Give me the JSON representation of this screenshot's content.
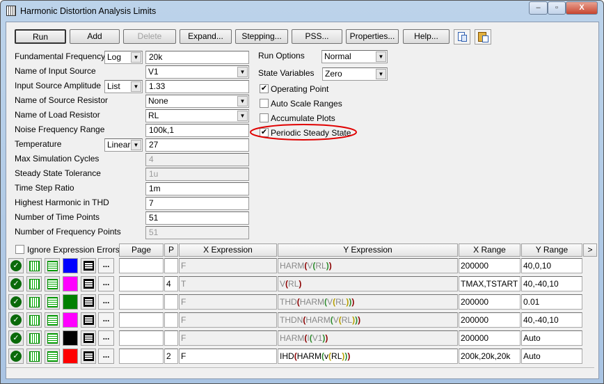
{
  "window": {
    "title": "Harmonic Distortion Analysis Limits",
    "minimize": "–",
    "maximize": "▫",
    "close": "X"
  },
  "toolbar": {
    "buttons": [
      {
        "label": "Run",
        "enabled": true
      },
      {
        "label": "Add",
        "enabled": true
      },
      {
        "label": "Delete",
        "enabled": false
      },
      {
        "label": "Expand...",
        "enabled": true
      },
      {
        "label": "Stepping...",
        "enabled": true
      },
      {
        "label": "PSS...",
        "enabled": true
      },
      {
        "label": "Properties...",
        "enabled": true
      },
      {
        "label": "Help...",
        "enabled": true
      }
    ],
    "copy_icon": "copy-icon",
    "paste_icon": "paste-icon"
  },
  "fields": [
    {
      "label": "Fundamental Frequency",
      "mode": "Log",
      "value": "20k",
      "type": "text"
    },
    {
      "label": "Name of Input Source",
      "value": "V1",
      "type": "dropdown"
    },
    {
      "label": "Input Source Amplitude",
      "mode": "List",
      "value": "1.33",
      "type": "text"
    },
    {
      "label": "Name of Source Resistor",
      "value": "None",
      "type": "dropdown"
    },
    {
      "label": "Name of Load Resistor",
      "value": "RL",
      "type": "dropdown"
    },
    {
      "label": "Noise Frequency Range",
      "value": "100k,1",
      "type": "text"
    },
    {
      "label": "Temperature",
      "mode": "Linear",
      "value": "27",
      "type": "text"
    },
    {
      "label": "Max Simulation Cycles",
      "value": "4",
      "type": "readonly"
    },
    {
      "label": "Steady State Tolerance",
      "value": "1u",
      "type": "readonly"
    },
    {
      "label": "Time Step Ratio",
      "value": "1m",
      "type": "text"
    },
    {
      "label": "Highest Harmonic in THD",
      "value": "7",
      "type": "text"
    },
    {
      "label": "Number of Time Points",
      "value": "51",
      "type": "text"
    },
    {
      "label": "Number of Frequency Points",
      "value": "51",
      "type": "readonly"
    }
  ],
  "options": {
    "run_options_label": "Run Options",
    "run_options_value": "Normal",
    "state_variables_label": "State Variables",
    "state_variables_value": "Zero",
    "checkboxes": [
      {
        "label": "Operating Point",
        "checked": true
      },
      {
        "label": "Auto Scale Ranges",
        "checked": false
      },
      {
        "label": "Accumulate Plots",
        "checked": false
      },
      {
        "label": "Periodic Steady State",
        "checked": true,
        "highlighted": true
      }
    ]
  },
  "grid": {
    "ignore_errors_label": "Ignore Expression Errors",
    "ignore_errors_checked": false,
    "headers": {
      "page": "Page",
      "p": "P",
      "x_expr": "X Expression",
      "y_expr": "Y Expression",
      "x_range": "X Range",
      "y_range": "Y Range",
      "more": ">"
    },
    "rows": [
      {
        "color": "#0000ff",
        "page": "",
        "p": "",
        "x": "F",
        "y": "HARM(V(RL))",
        "xr": "200000",
        "yr": "40,0,10",
        "editable": false
      },
      {
        "color": "#ff00ff",
        "page": "",
        "p": "4",
        "x": "T",
        "y": "V(RL)",
        "xr": "TMAX,TSTART",
        "yr": "40,-40,10",
        "editable": false
      },
      {
        "color": "#008000",
        "page": "",
        "p": "",
        "x": "F",
        "y": "THD(HARM(V(RL)))",
        "xr": "200000",
        "yr": "0.01",
        "editable": false
      },
      {
        "color": "#ff00ff",
        "page": "",
        "p": "",
        "x": "F",
        "y": "THDN(HARM(V(RL)))",
        "xr": "200000",
        "yr": "40,-40,10",
        "editable": false
      },
      {
        "color": "#000000",
        "page": "",
        "p": "",
        "x": "F",
        "y": "HARM(I(V1))",
        "xr": "200000",
        "yr": "Auto",
        "editable": false
      },
      {
        "color": "#ff0000",
        "page": "",
        "p": "2",
        "x": "F",
        "y": "IHD(HARM(v(RL)))",
        "xr": "200k,20k,20k",
        "yr": "Auto",
        "editable": true
      }
    ],
    "more_label": "..."
  },
  "colors": {
    "paren_levels": [
      "#8b0000",
      "#2e8b2e",
      "#b8a000"
    ],
    "highlight": "#e00000"
  }
}
